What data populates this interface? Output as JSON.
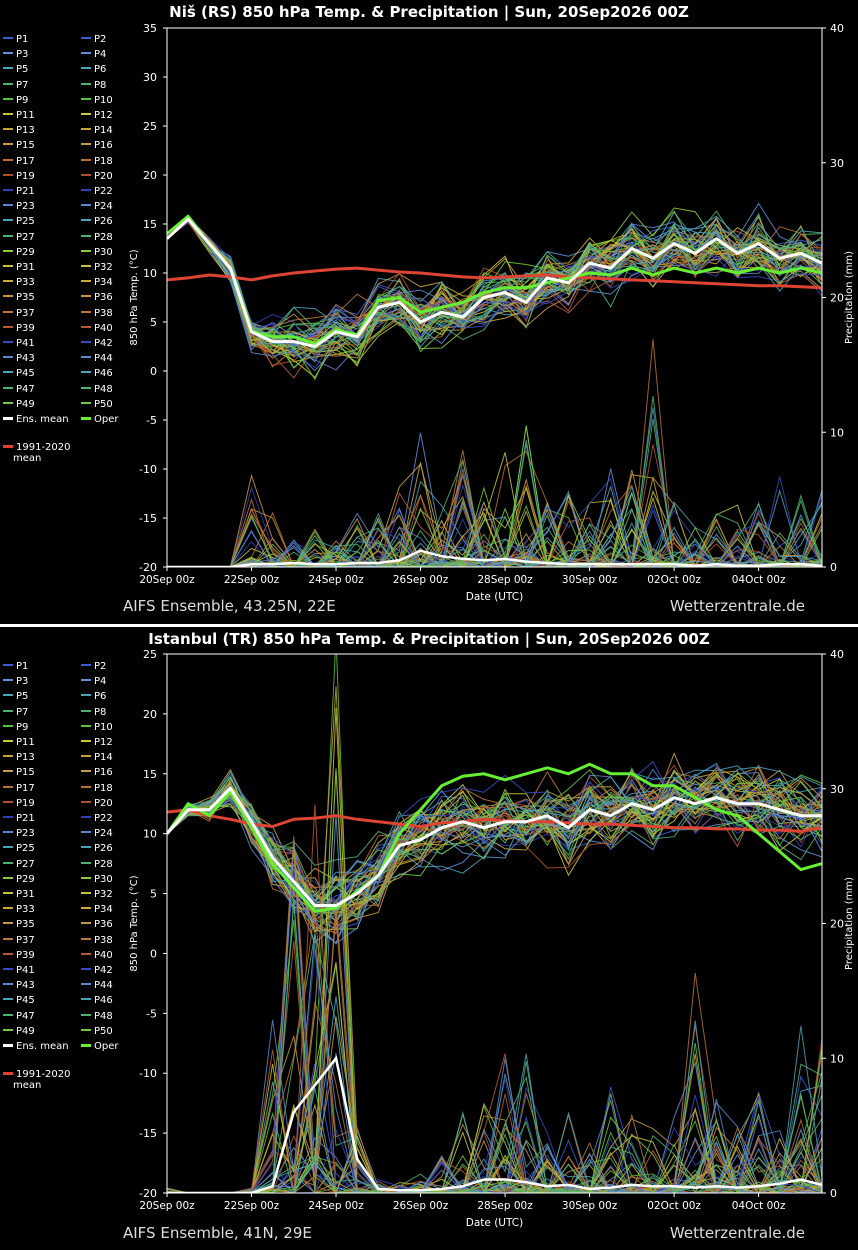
{
  "legend_entries": [
    "P1",
    "P2",
    "P3",
    "P4",
    "P5",
    "P6",
    "P7",
    "P8",
    "P9",
    "P10",
    "P11",
    "P12",
    "P13",
    "P14",
    "P15",
    "P16",
    "P17",
    "P18",
    "P19",
    "P20",
    "P21",
    "P22",
    "P23",
    "P24",
    "P25",
    "P26",
    "P27",
    "P28",
    "P29",
    "P30",
    "P31",
    "P32",
    "P33",
    "P34",
    "P35",
    "P36",
    "P37",
    "P38",
    "P39",
    "P40",
    "P41",
    "P42",
    "P43",
    "P44",
    "P45",
    "P46",
    "P47",
    "P48",
    "P49",
    "P50"
  ],
  "member_colors": [
    "#3b5bd6",
    "#3b5bd6",
    "#5f8fd8",
    "#5f8fd8",
    "#4fa3b8",
    "#4fa3b8",
    "#4fb06a",
    "#4fb06a",
    "#55c23b",
    "#55c23b",
    "#c8c832",
    "#c8c832",
    "#c8a032",
    "#c8a032",
    "#c89a3c",
    "#c89a3c",
    "#b8702e",
    "#b8702e",
    "#b0502a",
    "#b0502a",
    "#3040b0",
    "#3040b0",
    "#5a86d0",
    "#5a86d0",
    "#4aa0b8",
    "#4aa0b8",
    "#4db070",
    "#4db070",
    "#8bc83a",
    "#8bc83a",
    "#c8c23a",
    "#c8c23a",
    "#c8aa3a",
    "#c8aa3a",
    "#c89444",
    "#c89444",
    "#b87a38",
    "#b87a38",
    "#b85a30",
    "#b85a30",
    "#3848c0",
    "#3848c0",
    "#5c88d0",
    "#5c88d0",
    "#4aa2b8",
    "#4aa2b8",
    "#50b070",
    "#50b070",
    "#6cc83c",
    "#6cc83c"
  ],
  "legend_extra": {
    "ens_mean": "Ens. mean",
    "oper": "Oper",
    "clim_line1": "1991-2020",
    "clim_line2": "mean"
  },
  "colors": {
    "ens_mean": "#ffffff",
    "oper": "#66ee33",
    "clim_mean": "#dd4433",
    "axis": "#ffffff",
    "background": "#000000"
  },
  "panels": [
    {
      "title": "Niš  (RS)  850 hPa Temp. & Precipitation | Sun, 20Sep2026 00Z",
      "footer_left": "AIFS Ensemble, 43.25N, 22E",
      "footer_right": "Wetterzentrale.de"
    },
    {
      "title": "Istanbul  (TR)  850 hPa Temp. & Precipitation | Sun, 20Sep2026 00Z",
      "footer_left": "AIFS Ensemble, 41N, 29E",
      "footer_right": "Wetterzentrale.de"
    }
  ],
  "chart_data": [
    {
      "type": "line",
      "xlabel": "Date (UTC)",
      "ylabel": "850 hPa Temp. (°C)",
      "y2label": "Precipitation (mm)",
      "x_ticks": [
        "20Sep 00z",
        "22Sep 00z",
        "24Sep 00z",
        "26Sep 00z",
        "28Sep 00z",
        "30Sep 00z",
        "02Oct 00z",
        "04Oct 00z"
      ],
      "x_range_days": [
        0,
        15.5
      ],
      "ylim": [
        -20,
        35
      ],
      "y_ticks": [
        35,
        30,
        25,
        20,
        15,
        10,
        5,
        0,
        -5,
        -10,
        -15,
        -20
      ],
      "y2lim": [
        0,
        40
      ],
      "y2_ticks": [
        40,
        30,
        20,
        10,
        0
      ],
      "grid": false,
      "temp_spread": 3.5,
      "x": [
        0,
        0.5,
        1,
        1.5,
        2,
        2.5,
        3,
        3.5,
        4,
        4.5,
        5,
        5.5,
        6,
        6.5,
        7,
        7.5,
        8,
        8.5,
        9,
        9.5,
        10,
        10.5,
        11,
        11.5,
        12,
        12.5,
        13,
        13.5,
        14,
        14.5,
        15,
        15.5
      ],
      "series": [
        {
          "name": "Ens. mean",
          "values": [
            13.5,
            15.5,
            13,
            10.5,
            4,
            3,
            3,
            2.5,
            4,
            3.5,
            6.5,
            7,
            5,
            6,
            5.5,
            7.5,
            8,
            7,
            9.5,
            9,
            11,
            10.5,
            12.5,
            11.5,
            13,
            12,
            13.5,
            12,
            13,
            11.5,
            12,
            11
          ]
        },
        {
          "name": "Oper",
          "values": [
            14,
            15.8,
            13,
            10.5,
            4,
            3.5,
            3.5,
            2.8,
            4.2,
            3.7,
            7.2,
            7.5,
            6,
            6.5,
            7,
            8,
            8.5,
            8.5,
            9,
            9.5,
            10,
            9.8,
            10.5,
            9.8,
            10.5,
            10,
            10.5,
            10,
            10.5,
            10,
            10.5,
            10
          ]
        },
        {
          "name": "1991-2020 mean",
          "values": [
            9.3,
            9.5,
            9.8,
            9.6,
            9.3,
            9.7,
            10,
            10.2,
            10.4,
            10.5,
            10.3,
            10.1,
            10,
            9.8,
            9.6,
            9.5,
            9.6,
            9.7,
            9.8,
            9.6,
            9.5,
            9.4,
            9.3,
            9.2,
            9.1,
            9.0,
            8.9,
            8.8,
            8.7,
            8.7,
            8.6,
            8.5
          ]
        }
      ],
      "precip_mean": [
        0,
        0,
        0,
        0,
        0.2,
        0.2,
        0.3,
        0.2,
        0.2,
        0.3,
        0.3,
        0.5,
        1.2,
        0.8,
        0.6,
        0.5,
        0.6,
        0.4,
        0.3,
        0.2,
        0.2,
        0.2,
        0.2,
        0.2,
        0.2,
        0.1,
        0.2,
        0.1,
        0.1,
        0.2,
        0.2,
        0.1
      ],
      "precip_max": [
        0,
        0,
        0,
        0,
        9,
        4,
        2,
        3,
        2,
        4,
        4,
        6,
        10,
        7,
        9,
        6,
        9,
        12,
        5,
        6,
        5,
        8,
        8,
        18,
        5,
        3,
        4,
        5,
        5,
        7,
        6,
        7
      ]
    },
    {
      "type": "line",
      "xlabel": "Date (UTC)",
      "ylabel": "850 hPa Temp. (°C)",
      "y2label": "Precipitation (mm)",
      "x_ticks": [
        "20Sep 00z",
        "22Sep 00z",
        "24Sep 00z",
        "26Sep 00z",
        "28Sep 00z",
        "30Sep 00z",
        "02Oct 00z",
        "04Oct 00z"
      ],
      "x_range_days": [
        0,
        15.5
      ],
      "ylim": [
        -20,
        25
      ],
      "y_ticks": [
        25,
        20,
        15,
        10,
        5,
        0,
        -5,
        -10,
        -15,
        -20
      ],
      "y2lim": [
        0,
        40
      ],
      "y2_ticks": [
        40,
        30,
        20,
        10,
        0
      ],
      "grid": false,
      "temp_spread": 3.5,
      "x": [
        0,
        0.5,
        1,
        1.5,
        2,
        2.5,
        3,
        3.5,
        4,
        4.5,
        5,
        5.5,
        6,
        6.5,
        7,
        7.5,
        8,
        8.5,
        9,
        9.5,
        10,
        10.5,
        11,
        11.5,
        12,
        12.5,
        13,
        13.5,
        14,
        14.5,
        15,
        15.5
      ],
      "series": [
        {
          "name": "Ens. mean",
          "values": [
            10,
            12,
            12,
            13.8,
            11,
            8,
            6,
            4,
            4,
            5,
            6.5,
            9,
            9.5,
            10.5,
            11,
            10.5,
            11,
            11,
            11.5,
            10.5,
            12,
            11.5,
            12.5,
            12,
            13,
            12.5,
            13,
            12.5,
            12.5,
            12,
            11.5,
            11.5
          ]
        },
        {
          "name": "Oper",
          "values": [
            10,
            12.5,
            11.5,
            13.5,
            10.5,
            7.5,
            5.5,
            3.5,
            3.8,
            5.2,
            6.5,
            10,
            12,
            14,
            14.8,
            15,
            14.5,
            15,
            15.5,
            15,
            15.8,
            15,
            15,
            14,
            14,
            13,
            12,
            11.5,
            10,
            8.5,
            7,
            7.5
          ]
        },
        {
          "name": "1991-2020 mean",
          "values": [
            11.8,
            12,
            11.5,
            11.2,
            10.8,
            10.6,
            11.2,
            11.3,
            11.5,
            11.2,
            11,
            10.8,
            10.6,
            10.9,
            11,
            11.2,
            11.1,
            11,
            11,
            10.9,
            10.8,
            10.8,
            10.7,
            10.6,
            10.5,
            10.5,
            10.4,
            10.4,
            10.3,
            10.3,
            10.2,
            10.5
          ]
        }
      ],
      "precip_mean": [
        0,
        0,
        0,
        0,
        0,
        0.5,
        6,
        8,
        10,
        2.5,
        0.3,
        0.2,
        0.2,
        0.3,
        0.5,
        1,
        1,
        0.8,
        0.5,
        0.6,
        0.3,
        0.4,
        0.6,
        0.5,
        0.5,
        0.4,
        0.5,
        0.4,
        0.5,
        0.7,
        1,
        0.6
      ],
      "precip_max": [
        0.5,
        0.3,
        0.3,
        0.2,
        0.5,
        15,
        28,
        38,
        45,
        5,
        1,
        0.8,
        2,
        3,
        6,
        7,
        11,
        13,
        5,
        6,
        4,
        8,
        6,
        5,
        6,
        18,
        8,
        5,
        8,
        6,
        13,
        12
      ]
    }
  ]
}
